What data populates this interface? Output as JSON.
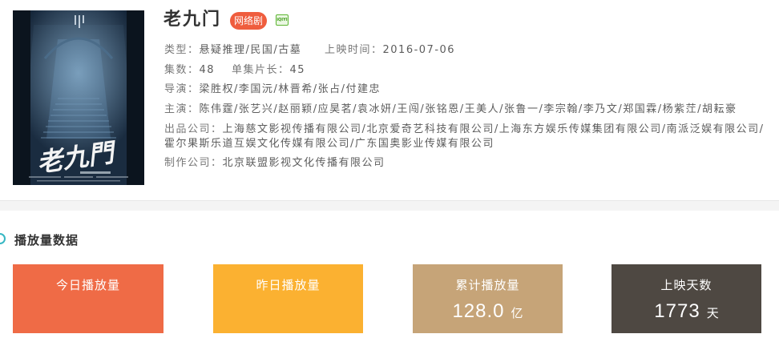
{
  "show": {
    "title": "老九门",
    "badge": "网络剧",
    "platform_logo_text": "iQIYI",
    "poster_title_art": "老九門"
  },
  "info": {
    "genre_label": "类型：",
    "genre_value": "悬疑推理/民国/古墓",
    "release_label": "上映时间：",
    "release_value": "2016-07-06",
    "episodes_label": "集数：",
    "episodes_value": "48",
    "episode_length_label": "单集片长：",
    "episode_length_value": "45",
    "director_label": "导演：",
    "director_value": "梁胜权/李国沅/林晋希/张占/付建忠",
    "cast_label": "主演：",
    "cast_value": "陈伟霆/张艺兴/赵丽颖/应昊茗/袁冰妍/王闯/张铭恩/王美人/张鲁一/李宗翰/李乃文/郑国霖/杨紫茳/胡耘豪",
    "producer_label": "出品公司：",
    "producer_value_line1": "上海慈文影视传播有限公司/北京爱奇艺科技有限公司/上海东方娱乐传媒集团有限公司/南派泛娱有限公司/",
    "producer_value_line2": "霍尔果斯乐道互娱文化传媒有限公司/广东国奥影业传媒有限公司",
    "production_label": "制作公司：",
    "production_value": "北京联盟影视文化传播有限公司"
  },
  "playback": {
    "section_title": "播放量数据",
    "section_icon": "circle-icon",
    "cards": [
      {
        "label": "今日播放量",
        "color": "#EF6B46"
      },
      {
        "label": "昨日播放量",
        "color": "#FBB131"
      },
      {
        "label": "累计播放量",
        "value": "128.0",
        "unit": "亿",
        "color": "#C6A478"
      },
      {
        "label": "上映天数",
        "value": "1773",
        "unit": "天",
        "color": "#4E4842"
      }
    ]
  },
  "colors": {
    "badge": "#EF5D3E",
    "section_icon": "#37B7C3",
    "platform_logo": "#5CB531"
  }
}
